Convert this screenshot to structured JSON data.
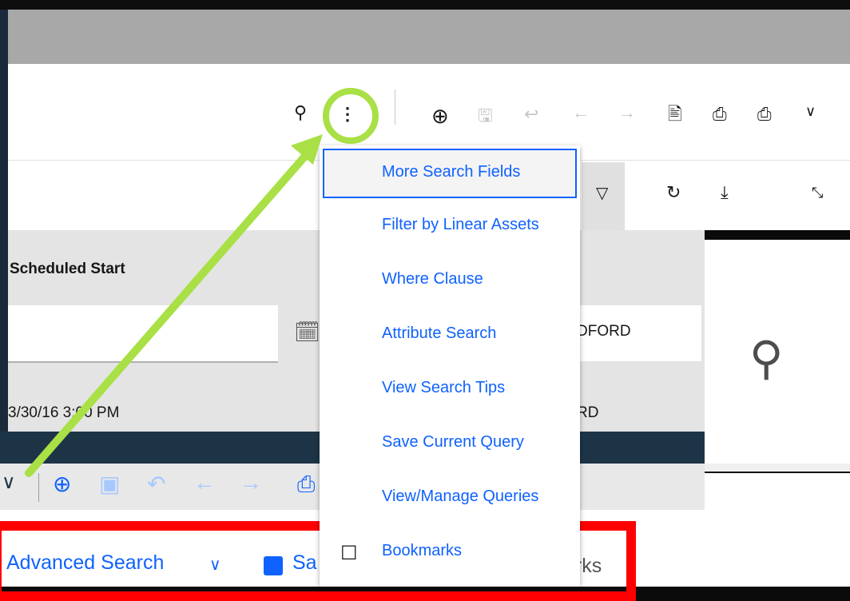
{
  "header_toolbar": {
    "icons": [
      "search-icon",
      "overflow-menu-icon",
      "add-icon",
      "save-icon",
      "undo-icon",
      "back-icon",
      "forward-icon",
      "document-icon",
      "print-icon",
      "print-preview-icon",
      "chevron-down-icon"
    ]
  },
  "filter_toolbar": {
    "icons": [
      "filter-icon",
      "refresh-icon",
      "download-icon",
      "minimize-icon"
    ]
  },
  "table": {
    "column_header": "Scheduled Start",
    "row_date": "3/30/16 3:00 PM",
    "owner_filter_value": "DFORD",
    "owner_row_value": "RD"
  },
  "menu": {
    "items": [
      {
        "label": "More Search Fields"
      },
      {
        "label": "Filter by Linear Assets"
      },
      {
        "label": "Where Clause"
      },
      {
        "label": "Attribute Search"
      },
      {
        "label": "View Search Tips"
      },
      {
        "label": "Save Current Query"
      },
      {
        "label": "View/Manage Queries"
      },
      {
        "label": "Bookmarks"
      }
    ]
  },
  "lower_toolbar": {
    "advanced_search": "Advanced Search",
    "save_partial": "Sa",
    "bookmarks_partial": "arks"
  },
  "colors": {
    "accent": "#0f62fe",
    "highlight": "#a8e045",
    "red_box": "#ff0000"
  }
}
